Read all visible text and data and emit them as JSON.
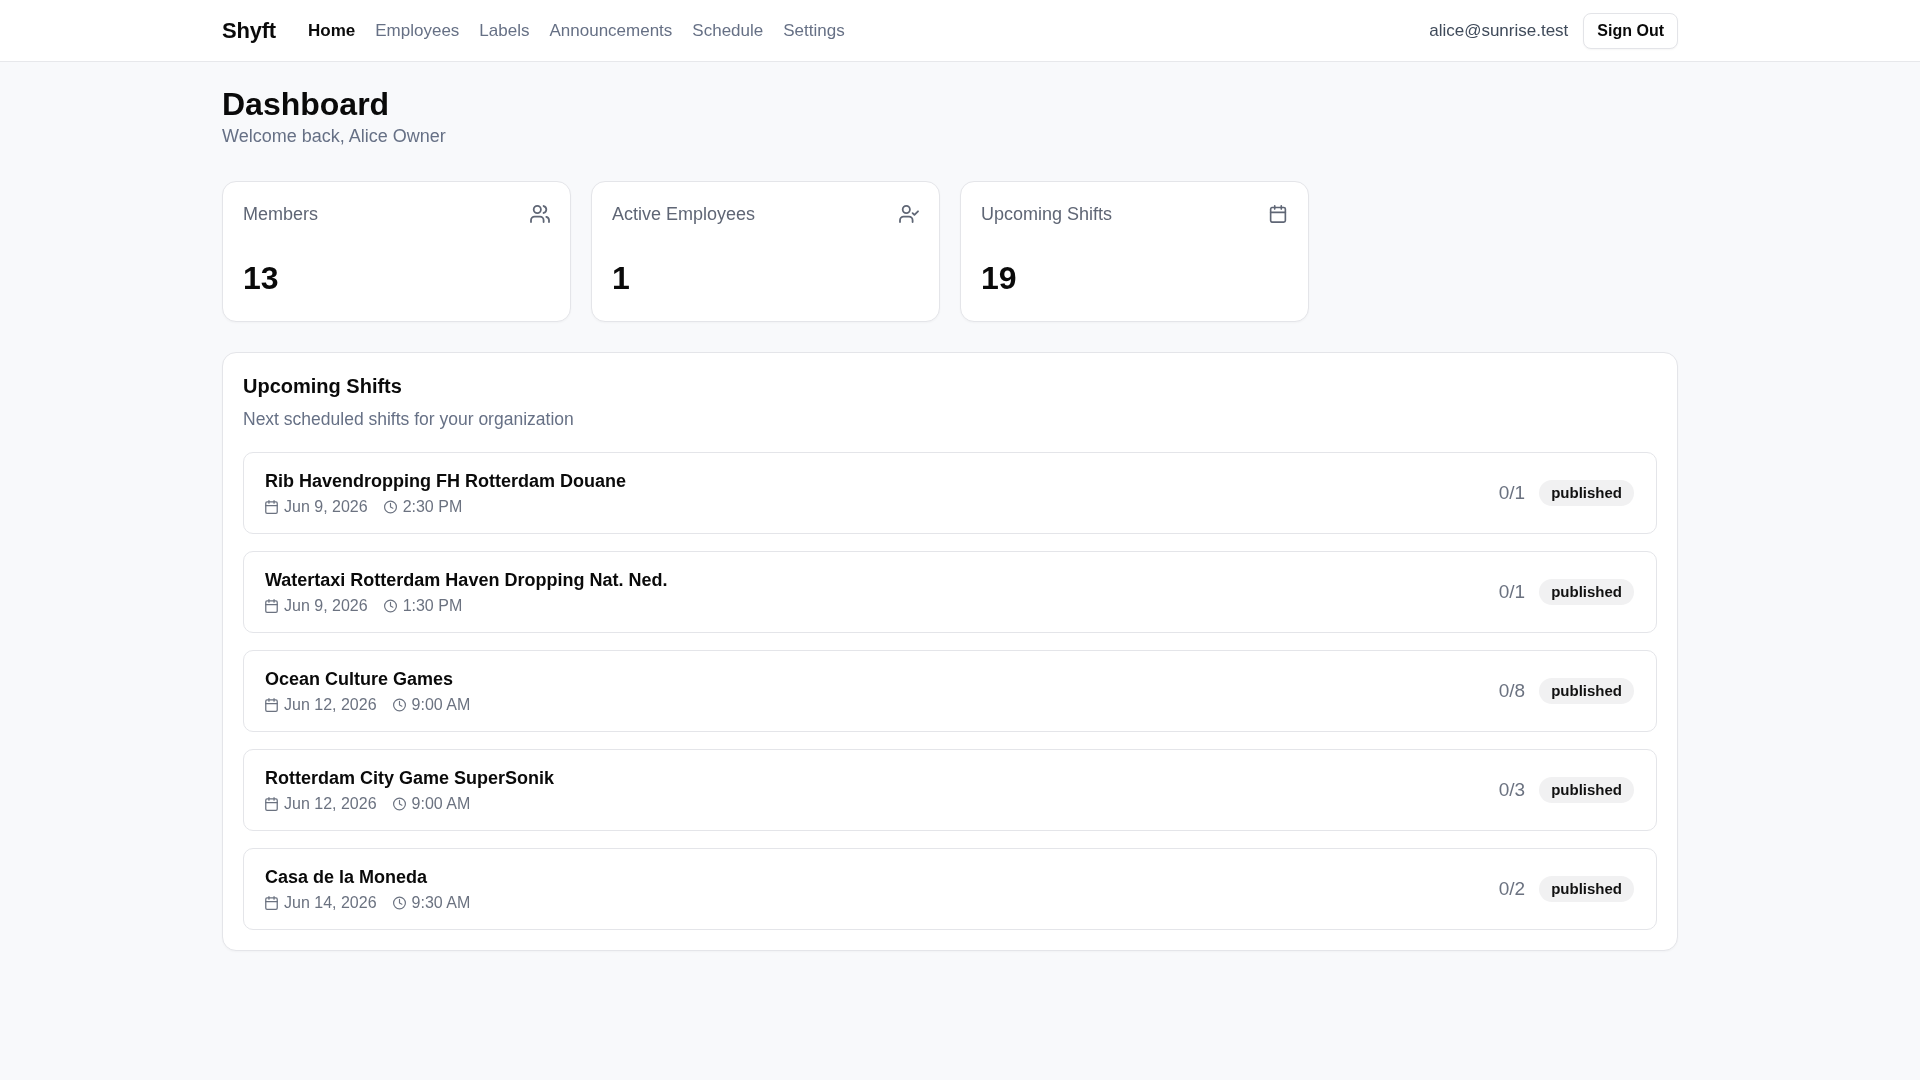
{
  "nav": {
    "logo": "Shyft",
    "links": [
      {
        "label": "Home",
        "selected": true
      },
      {
        "label": "Employees",
        "selected": false
      },
      {
        "label": "Labels",
        "selected": false
      },
      {
        "label": "Announcements",
        "selected": false
      },
      {
        "label": "Schedule",
        "selected": false
      },
      {
        "label": "Settings",
        "selected": false
      }
    ],
    "user_email": "alice@sunrise.test",
    "sign_out": "Sign Out"
  },
  "header": {
    "title": "Dashboard",
    "subtitle": "Welcome back, Alice Owner"
  },
  "stats": [
    {
      "label": "Members",
      "value": "13"
    },
    {
      "label": "Active Employees",
      "value": "1"
    },
    {
      "label": "Upcoming Shifts",
      "value": "19"
    }
  ],
  "shifts_panel": {
    "title": "Upcoming Shifts",
    "subtitle": "Next scheduled shifts for your organization",
    "shifts": [
      {
        "title": "Rib Havendropping FH Rotterdam Douane",
        "date": "Jun 9, 2026",
        "time": "2:30 PM",
        "filled": "0/1",
        "status": "published"
      },
      {
        "title": "Watertaxi Rotterdam Haven Dropping Nat. Ned.",
        "date": "Jun 9, 2026",
        "time": "1:30 PM",
        "filled": "0/1",
        "status": "published"
      },
      {
        "title": "Ocean Culture Games",
        "date": "Jun 12, 2026",
        "time": "9:00 AM",
        "filled": "0/8",
        "status": "published"
      },
      {
        "title": "Rotterdam City Game SuperSonik",
        "date": "Jun 12, 2026",
        "time": "9:00 AM",
        "filled": "0/3",
        "status": "published"
      },
      {
        "title": "Casa de la Moneda",
        "date": "Jun 14, 2026",
        "time": "9:30 AM",
        "filled": "0/2",
        "status": "published"
      }
    ]
  }
}
